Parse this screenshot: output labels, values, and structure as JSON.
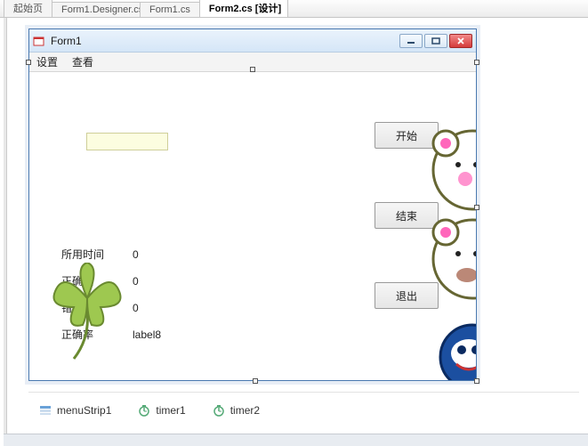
{
  "tabs": {
    "t0": "起始页",
    "t1": "Form1.Designer.cs",
    "t2": "Form1.cs",
    "t3": "Form2.cs [设计]"
  },
  "window": {
    "title": "Form1",
    "min": "▁",
    "max": "☐",
    "close": "X"
  },
  "menu": {
    "settings": "设置",
    "view": "查看"
  },
  "buttons": {
    "start": "开始",
    "end": "结束",
    "exit": "退出"
  },
  "labels": {
    "time_k": "所用时间",
    "time_v": "0",
    "correct_k": "正确数",
    "correct_v": "0",
    "wrong_k": "错误数",
    "wrong_v": "0",
    "rate_k": "正确率",
    "rate_v": "label8"
  },
  "tray": {
    "menustrip": "menuStrip1",
    "timer1": "timer1",
    "timer2": "timer2"
  }
}
